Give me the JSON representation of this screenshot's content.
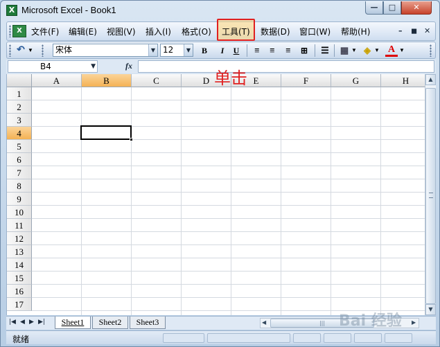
{
  "window": {
    "title": "Microsoft Excel - Book1",
    "app_icon": "excel-icon"
  },
  "title_controls": {
    "minimize": "—",
    "maximize": "□",
    "close": "✕"
  },
  "menu": {
    "items": [
      "文件(F)",
      "编辑(E)",
      "视图(V)",
      "插入(I)",
      "格式(O)",
      "工具(T)",
      "数据(D)",
      "窗口(W)",
      "帮助(H)"
    ],
    "highlighted": "工具(T)",
    "doc_controls": [
      "–",
      "◼",
      "✕"
    ]
  },
  "toolbar": {
    "undo": "↶",
    "font_name": "宋体",
    "font_size": "12",
    "bold": "B",
    "italic": "I",
    "underline": "U",
    "font_color_letter": "A"
  },
  "formula_bar": {
    "name_box": "B4",
    "fx_label": "fx",
    "formula_value": ""
  },
  "annotation": "单击",
  "grid": {
    "columns": [
      "A",
      "B",
      "C",
      "D",
      "E",
      "F",
      "G",
      "H"
    ],
    "rows": [
      "1",
      "2",
      "3",
      "4",
      "5",
      "6",
      "7",
      "8",
      "9",
      "10",
      "11",
      "12",
      "13",
      "14",
      "15",
      "16",
      "17"
    ],
    "active_column": "B",
    "active_row": "4",
    "active_cell": "B4"
  },
  "sheets": {
    "tabs": [
      "Sheet1",
      "Sheet2",
      "Sheet3"
    ],
    "active": "Sheet1"
  },
  "status": {
    "text": "就绪"
  },
  "watermark": "Bai 经验",
  "colors": {
    "highlight_border": "#e02020",
    "active_header": "#f4b254",
    "annotation": "#e02020"
  }
}
